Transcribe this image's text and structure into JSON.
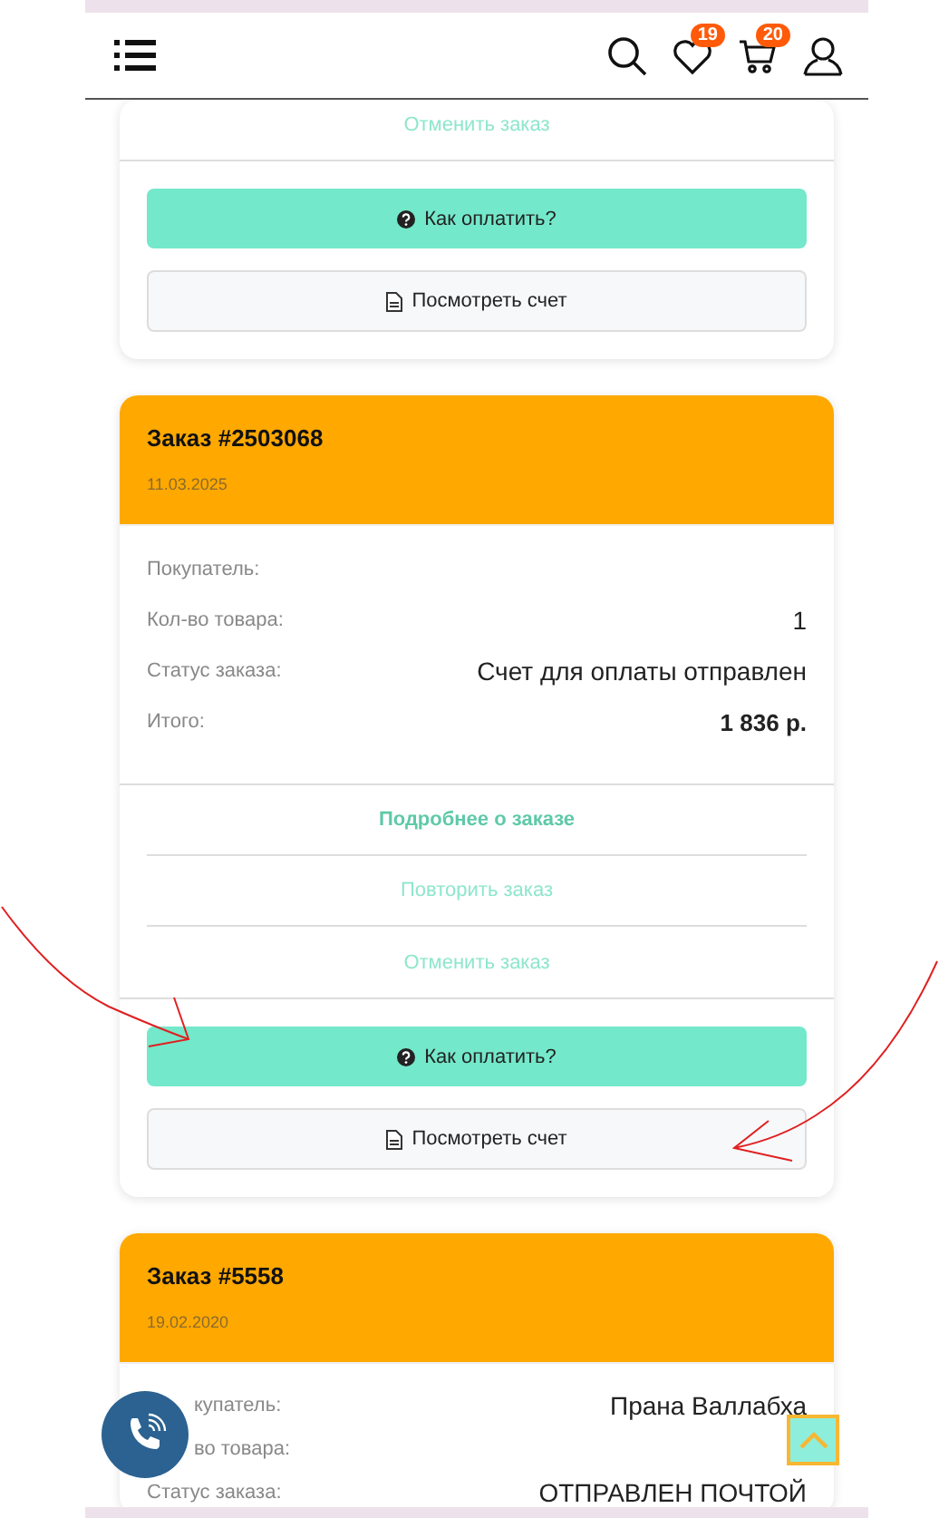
{
  "header": {
    "wishlist_count": "19",
    "cart_count": "20"
  },
  "orders": [
    {
      "links": [
        {
          "kind": "action",
          "label": "Отменить заказ"
        }
      ],
      "buttons": [
        {
          "kind": "pay",
          "label": "Как оплатить?"
        },
        {
          "kind": "invoice",
          "label": "Посмотреть счет"
        }
      ]
    },
    {
      "title": "Заказ #2503068",
      "date": "11.03.2025",
      "rows": [
        {
          "kind": "plain",
          "label": "Покупатель:"
        },
        {
          "kind": "plain",
          "label": "Кол-во товара:",
          "value": "1"
        },
        {
          "kind": "plain",
          "label": "Статус заказа:",
          "value": "Счет для оплаты отправлен"
        },
        {
          "kind": "total",
          "label": "Итого:",
          "value": "1 836 р."
        }
      ],
      "links": [
        {
          "kind": "details",
          "label": "Подробнее о заказе"
        },
        {
          "kind": "action",
          "label": "Повторить заказ"
        },
        {
          "kind": "action",
          "label": "Отменить заказ"
        }
      ],
      "buttons": [
        {
          "kind": "pay",
          "label": "Как оплатить?"
        },
        {
          "kind": "invoice",
          "label": "Посмотреть счет"
        }
      ]
    },
    {
      "title": "Заказ #5558",
      "date": "19.02.2020",
      "rows": [
        {
          "kind": "plain",
          "label": "купатель:",
          "value": "Прана Валлабха"
        },
        {
          "kind": "plain",
          "label": "во товара:"
        },
        {
          "kind": "plain",
          "label": "Статус заказа:",
          "value": "ОТПРАВЛЕН ПОЧТОЙ"
        }
      ]
    }
  ]
}
